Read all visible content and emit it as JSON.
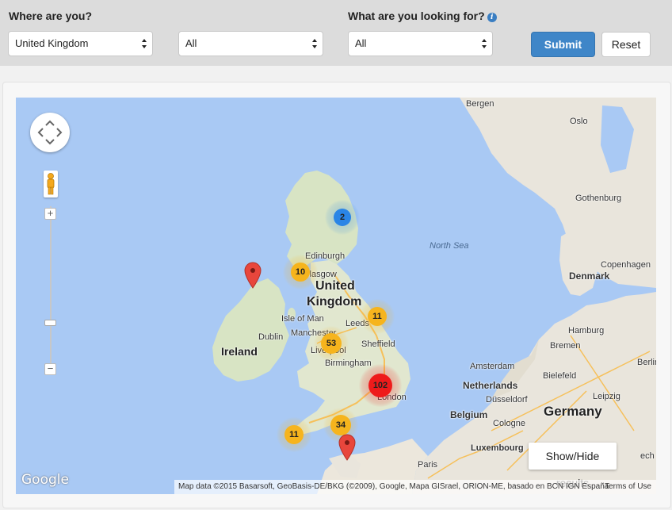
{
  "filters": {
    "location_label": "Where are you?",
    "looking_for_label": "What are you looking for?",
    "info_glyph": "i",
    "country_value": "United Kingdom",
    "region_value": "All",
    "category_value": "All",
    "submit_label": "Submit",
    "reset_label": "Reset"
  },
  "map": {
    "places": {
      "bergen": "Bergen",
      "oslo": "Oslo",
      "gothenburg": "Gothenburg",
      "north_sea": "North Sea",
      "copenhagen": "Copenhagen",
      "denmark": "Denmark",
      "edinburgh": "Edinburgh",
      "glasgow": "Glasgow",
      "united": "United",
      "kingdom": "Kingdom",
      "isle_of_man": "Isle of Man",
      "leeds": "Leeds",
      "manchester": "Manchester",
      "liverpool": "Liverpool",
      "sheffield": "Sheffield",
      "dublin": "Dublin",
      "ireland": "Ireland",
      "birmingham": "Birmingham",
      "london": "London",
      "hamburg": "Hamburg",
      "bremen": "Bremen",
      "berlin": "Berlin",
      "amsterdam": "Amsterdam",
      "bielefeld": "Bielefeld",
      "netherlands": "Netherlands",
      "dusseldorf": "Düsseldorf",
      "leipzig": "Leipzig",
      "belgium": "Belgium",
      "germany": "Germany",
      "cologne": "Cologne",
      "luxembourg": "Luxembourg",
      "paris": "Paris",
      "czech": "ech"
    },
    "clusters": [
      {
        "name": "aberdeen",
        "count": "2",
        "color": "#2a85e6"
      },
      {
        "name": "glasgow",
        "count": "10",
        "color": "#f6b41d"
      },
      {
        "name": "leeds",
        "count": "11",
        "color": "#f6b41d"
      },
      {
        "name": "manchester",
        "count": "53",
        "color": "#f6b41d"
      },
      {
        "name": "london",
        "count": "102",
        "color": "#ee1b1b"
      },
      {
        "name": "south",
        "count": "34",
        "color": "#f6b41d"
      },
      {
        "name": "cornwall",
        "count": "11",
        "color": "#f6b41d"
      }
    ],
    "marker_color": "#e8463c",
    "controls": {
      "zoom_in": "+",
      "zoom_out": "−",
      "show_hide_label": "Show/Hide results"
    },
    "attribution": "Map data ©2015 Basarsoft, GeoBasis-DE/BKG (©2009), Google, Mapa GISrael, ORION-ME, basado en BCN IGN España",
    "terms": "Terms of Use",
    "logo": "Google"
  }
}
